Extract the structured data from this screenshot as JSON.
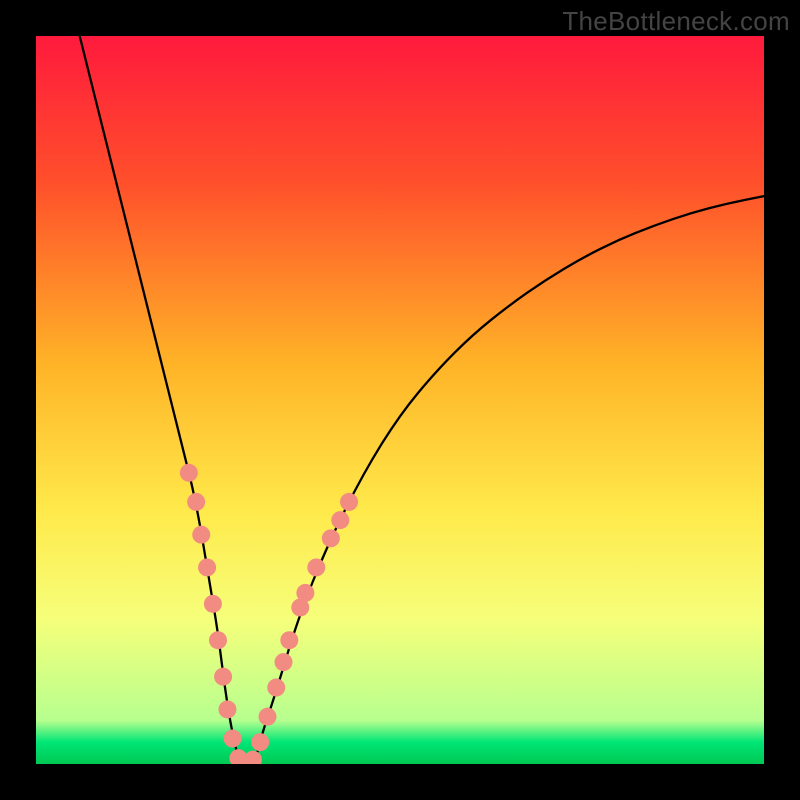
{
  "watermark": "TheBottleneck.com",
  "chart_data": {
    "type": "line",
    "title": "",
    "xlabel": "",
    "ylabel": "",
    "xlim": [
      0,
      100
    ],
    "ylim": [
      0,
      100
    ],
    "grid": false,
    "legend": false,
    "background_gradient": {
      "stops": [
        {
          "offset": 0.0,
          "color": "#ff1a3d"
        },
        {
          "offset": 0.2,
          "color": "#ff4f2b"
        },
        {
          "offset": 0.45,
          "color": "#ffb327"
        },
        {
          "offset": 0.65,
          "color": "#ffe94a"
        },
        {
          "offset": 0.8,
          "color": "#f6ff7a"
        },
        {
          "offset": 0.94,
          "color": "#b7ff8f"
        },
        {
          "offset": 0.97,
          "color": "#00e676"
        },
        {
          "offset": 1.0,
          "color": "#00c853"
        }
      ]
    },
    "series": [
      {
        "name": "bottleneck-curve",
        "color": "#000000",
        "width": 2.3,
        "x": [
          6,
          8,
          10,
          12,
          14,
          16,
          18,
          20,
          22,
          24,
          25,
          26,
          27,
          28,
          29,
          30,
          31,
          33,
          36,
          40,
          45,
          50,
          55,
          60,
          65,
          70,
          75,
          80,
          85,
          90,
          95,
          100
        ],
        "y": [
          100,
          92,
          84,
          76,
          68,
          60,
          52,
          44,
          36,
          24,
          18,
          10,
          4,
          0,
          0,
          0,
          4,
          10,
          20,
          30,
          40,
          48,
          54,
          59,
          63,
          66.5,
          69.5,
          72,
          74,
          75.7,
          77,
          78
        ]
      }
    ],
    "markers": {
      "name": "sample-points",
      "color": "#f28b82",
      "radius": 9,
      "points": [
        {
          "x": 21.0,
          "y": 40.0
        },
        {
          "x": 22.0,
          "y": 36.0
        },
        {
          "x": 22.7,
          "y": 31.5
        },
        {
          "x": 23.5,
          "y": 27.0
        },
        {
          "x": 24.3,
          "y": 22.0
        },
        {
          "x": 25.0,
          "y": 17.0
        },
        {
          "x": 25.7,
          "y": 12.0
        },
        {
          "x": 26.3,
          "y": 7.5
        },
        {
          "x": 27.0,
          "y": 3.5
        },
        {
          "x": 27.8,
          "y": 0.8
        },
        {
          "x": 28.8,
          "y": 0.0
        },
        {
          "x": 29.8,
          "y": 0.6
        },
        {
          "x": 30.8,
          "y": 3.0
        },
        {
          "x": 31.8,
          "y": 6.5
        },
        {
          "x": 33.0,
          "y": 10.5
        },
        {
          "x": 34.0,
          "y": 14.0
        },
        {
          "x": 34.8,
          "y": 17.0
        },
        {
          "x": 36.3,
          "y": 21.5
        },
        {
          "x": 37.0,
          "y": 23.5
        },
        {
          "x": 38.5,
          "y": 27.0
        },
        {
          "x": 40.5,
          "y": 31.0
        },
        {
          "x": 41.8,
          "y": 33.5
        },
        {
          "x": 43.0,
          "y": 36.0
        }
      ]
    }
  }
}
